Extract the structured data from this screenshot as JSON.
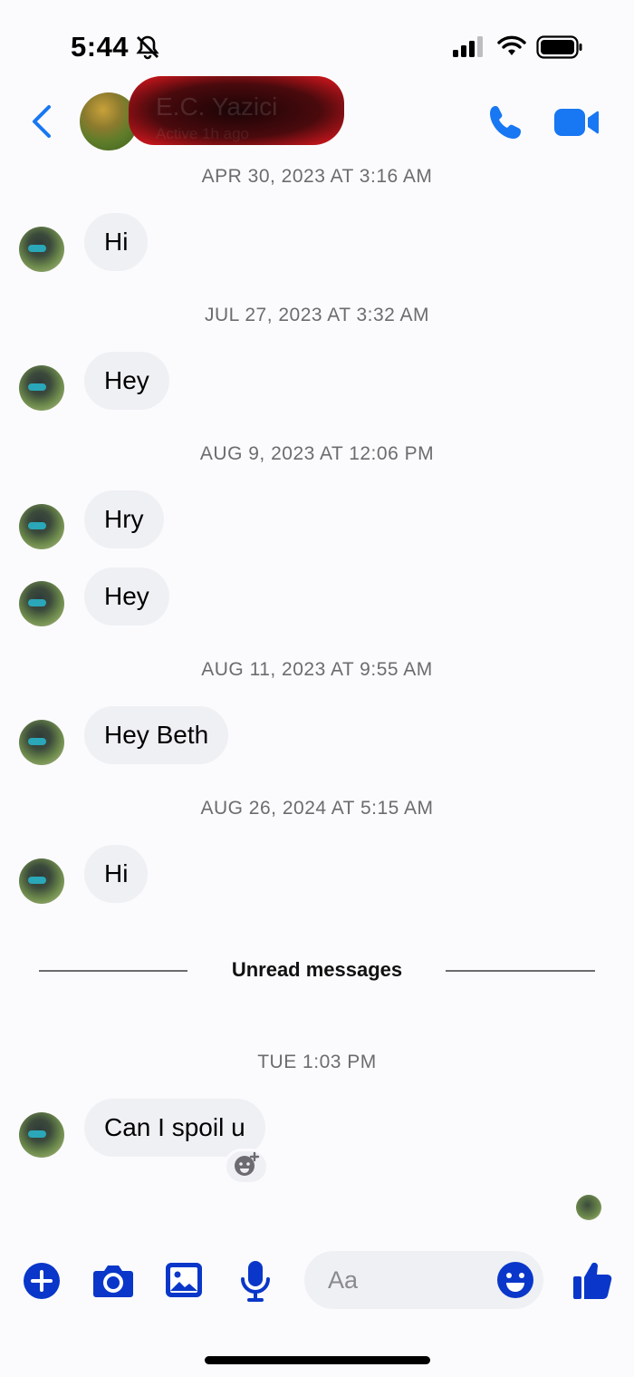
{
  "status_bar": {
    "time": "5:44"
  },
  "header": {
    "contact_name": "E.C. Yazici",
    "contact_status": "Active 1h ago"
  },
  "messages": [
    {
      "timestamp": "APR 30, 2023 AT 3:16 AM",
      "texts": [
        "Hi"
      ]
    },
    {
      "timestamp": "JUL 27, 2023 AT 3:32 AM",
      "texts": [
        "Hey"
      ]
    },
    {
      "timestamp": "AUG 9, 2023 AT 12:06 PM",
      "texts": [
        "Hry",
        "Hey"
      ]
    },
    {
      "timestamp": "AUG 11, 2023 AT 9:55 AM",
      "texts": [
        "Hey Beth"
      ]
    },
    {
      "timestamp": "AUG 26, 2024 AT 5:15 AM",
      "texts": [
        "Hi"
      ]
    },
    {
      "timestamp": "TUE 1:03 PM",
      "texts": [
        "Can I spoil u"
      ]
    }
  ],
  "unread_divider": "Unread messages",
  "composer": {
    "placeholder": "Aa"
  },
  "colors": {
    "accent": "#1877f2",
    "composer_icons": "#0a37c9",
    "bubble": "#eff0f4"
  }
}
